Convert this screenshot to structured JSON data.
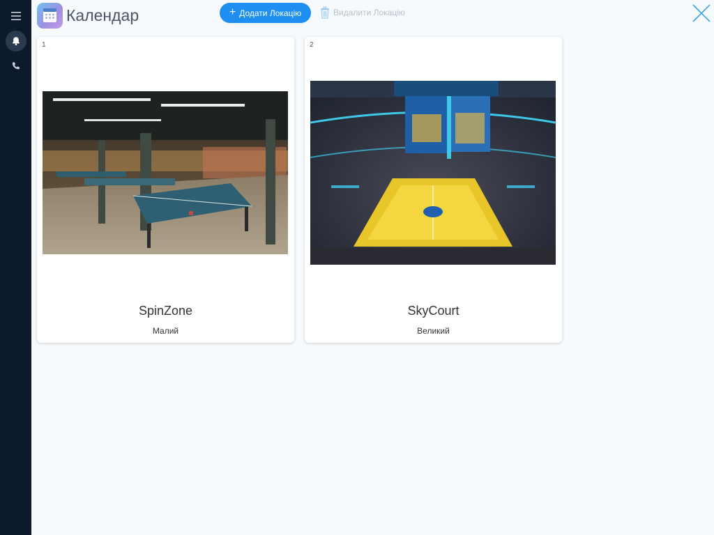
{
  "app": {
    "title": "Календар"
  },
  "toolbar": {
    "add_label": "Додати Локацію",
    "delete_label": "Видалити Локацію"
  },
  "colors": {
    "sidebar_bg": "#0d1a2b",
    "accent": "#1e8ff0",
    "close_icon": "#3aa3e6"
  },
  "sidebar": {
    "items": [
      {
        "icon": "menu-icon"
      },
      {
        "icon": "bell-icon",
        "active": true
      },
      {
        "icon": "phone-icon"
      }
    ]
  },
  "locations": [
    {
      "number": "1",
      "name": "SpinZone",
      "size": "Малий",
      "image": "table-tennis-hall-photo"
    },
    {
      "number": "2",
      "name": "SkyCourt",
      "size": "Великий",
      "image": "basketball-arena-photo"
    }
  ]
}
